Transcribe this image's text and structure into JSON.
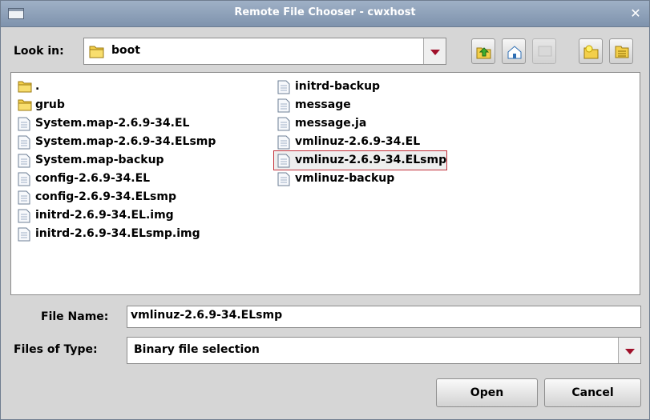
{
  "window": {
    "title": "Remote File Chooser - cwxhost",
    "close_glyph": "✕"
  },
  "lookin": {
    "label": "Look in:",
    "value": "boot",
    "icon": "folder-icon"
  },
  "toolbar": {
    "buttons": [
      {
        "name": "up-one-level-button",
        "icon": "folder-up-icon"
      },
      {
        "name": "home-button",
        "icon": "home-icon"
      },
      {
        "name": "desktop-button",
        "icon": "desktop-icon",
        "disabled": true
      },
      {
        "name": "new-folder-button",
        "icon": "new-folder-icon"
      },
      {
        "name": "details-view-button",
        "icon": "details-view-icon"
      }
    ]
  },
  "files": {
    "column1": [
      {
        "name": ".",
        "type": "folder"
      },
      {
        "name": "grub",
        "type": "folder"
      },
      {
        "name": "System.map-2.6.9-34.EL",
        "type": "file"
      },
      {
        "name": "System.map-2.6.9-34.ELsmp",
        "type": "file"
      },
      {
        "name": "System.map-backup",
        "type": "file"
      },
      {
        "name": "config-2.6.9-34.EL",
        "type": "file"
      },
      {
        "name": "config-2.6.9-34.ELsmp",
        "type": "file"
      },
      {
        "name": "initrd-2.6.9-34.EL.img",
        "type": "file"
      },
      {
        "name": "initrd-2.6.9-34.ELsmp.img",
        "type": "file"
      }
    ],
    "column2": [
      {
        "name": "initrd-backup",
        "type": "file"
      },
      {
        "name": "message",
        "type": "file"
      },
      {
        "name": "message.ja",
        "type": "file"
      },
      {
        "name": "vmlinuz-2.6.9-34.EL",
        "type": "file"
      },
      {
        "name": "vmlinuz-2.6.9-34.ELsmp",
        "type": "file",
        "selected": true
      },
      {
        "name": "vmlinuz-backup",
        "type": "file"
      }
    ]
  },
  "filename": {
    "label": "File Name:",
    "value": "vmlinuz-2.6.9-34.ELsmp"
  },
  "filetype": {
    "label": "Files of Type:",
    "value": "Binary file selection"
  },
  "buttons": {
    "open": "Open",
    "cancel": "Cancel"
  },
  "colors": {
    "selection_border": "#c2303a",
    "combo_arrow": "#a0102a",
    "titlebar": "#8fa1b8"
  }
}
